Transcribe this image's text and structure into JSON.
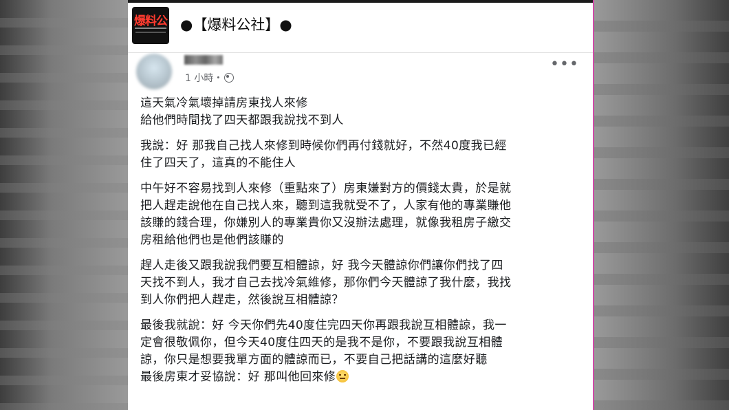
{
  "group": {
    "logo_text": "爆料公",
    "name": "●【爆料公社】●"
  },
  "post": {
    "time": "1 小時・",
    "paragraphs": [
      {
        "lines": [
          "這天氣冷氣壞掉請房東找人來修",
          "給他們時間找了四天都跟我說找不到人"
        ]
      },
      {
        "lines": [
          "我說：好 那我自己找人來修到時候你們再付錢就好，不然40度我已經",
          "住了四天了，這真的不能住人"
        ]
      },
      {
        "lines": [
          "中午好不容易找到人來修（重點來了）房東嫌對方的價錢太貴，於是就",
          "把人趕走說他在自己找人來，聽到這我就受不了，人家有他的專業賺他",
          "該賺的錢合理，你嫌別人的專業貴你又沒辦法處理，就像我租房子繳交",
          "房租給他們也是他們該賺的"
        ]
      },
      {
        "lines": [
          "趕人走後又跟我說我們要互相體諒，好 我今天體諒你們讓你們找了四",
          "天找不到人，我才自己去找冷氣維修，那你們今天體諒了我什麼，我找",
          "到人你們把人趕走，然後說互相體諒？"
        ]
      },
      {
        "lines": [
          "最後我就說：好 今天你們先40度住完四天你再跟我說互相體諒，我一",
          "定會很敬佩你，但今天40度住四天的是我不是你，不要跟我說互相體",
          "諒，你只是想要我單方面的體諒而已，不要自己把話講的這麼好聽",
          "最後房東才妥協說：好 那叫他回來修"
        ]
      }
    ]
  },
  "icons": {
    "globe": "globe-icon",
    "more": "more-options-icon",
    "emoji": "smile-emoji-icon"
  },
  "colors": {
    "divider_accent": "#d04aa8",
    "logo_text": "#ff3b2f"
  }
}
